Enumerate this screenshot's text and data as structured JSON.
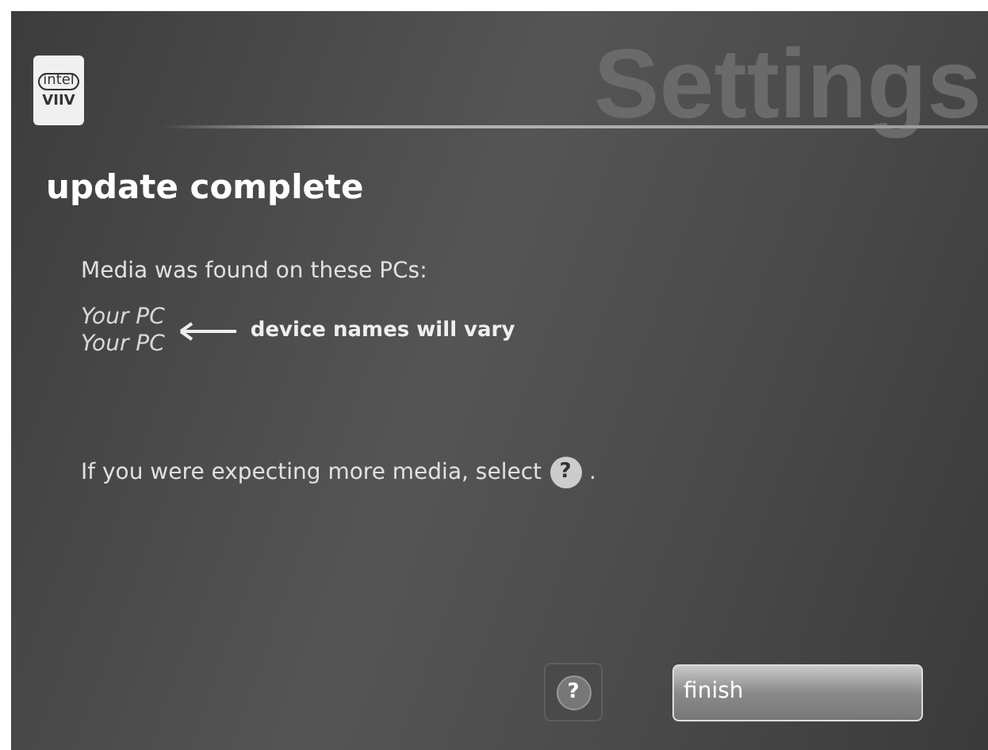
{
  "logo": {
    "top": "intel",
    "bottom": "VIIV"
  },
  "header": {
    "title": "Settings"
  },
  "heading": "update complete",
  "intro": "Media was found on these PCs:",
  "pcs": [
    "Your PC",
    "Your PC"
  ],
  "callout": "device names will vary",
  "hint": {
    "text": "If you were expecting more media, select",
    "icon": "?",
    "end": "."
  },
  "buttons": [
    {
      "kind": "help",
      "label": "?"
    },
    {
      "kind": "primary",
      "label": "finish"
    }
  ]
}
